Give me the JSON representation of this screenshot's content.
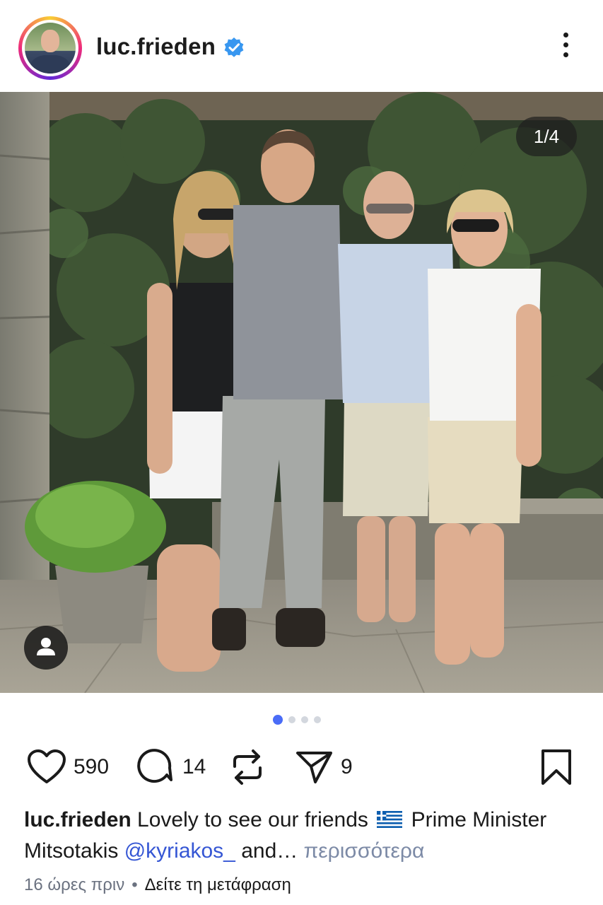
{
  "post": {
    "username": "luc.frieden",
    "verified": true,
    "avatar_icon": "profile-photo",
    "menu_icon": "more-vertical-icon"
  },
  "media": {
    "counter": "1/4",
    "image_count": 4,
    "active_index": 0,
    "tag_icon": "person-tag-icon"
  },
  "actions": {
    "likes": "590",
    "comments": "14",
    "reposts": "",
    "shares": "9"
  },
  "caption": {
    "username": "luc.frieden",
    "text_part1": " Lovely to see our friends ",
    "flag": "greece-flag",
    "text_part2": " Prime Minister Mitsotakis ",
    "mention": "@kyriakos_",
    "text_part3": " and… ",
    "more": "περισσότερα"
  },
  "meta": {
    "time": "16 ώρες πριν",
    "separator": "•",
    "translate": "Δείτε τη μετάφραση"
  },
  "colors": {
    "accent": "#4a6cf7",
    "mention": "#3556d4",
    "verified": "#3897f0"
  }
}
